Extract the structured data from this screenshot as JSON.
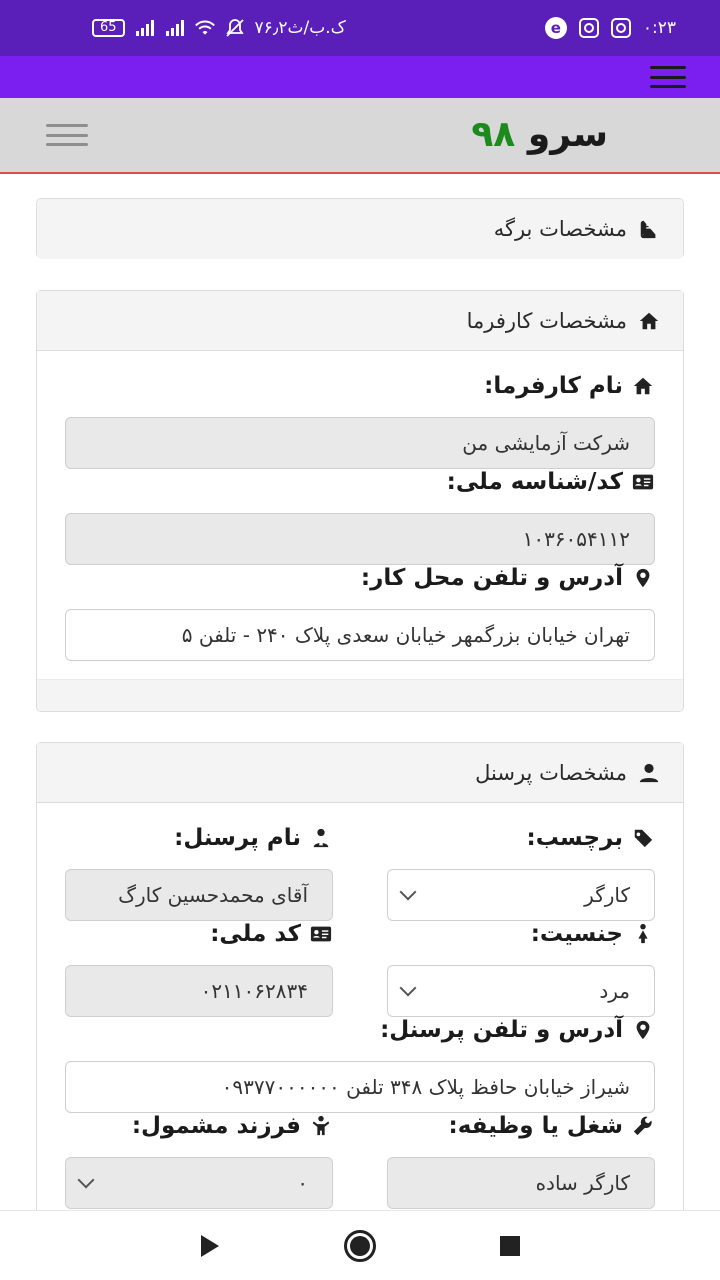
{
  "status_bar": {
    "time": "۰:۲۳",
    "network_speed": "۷۶٫۲ک.ب/ث",
    "battery": "65"
  },
  "header": {
    "brand_text": "سرو",
    "brand_number": "۹۸"
  },
  "sections": {
    "sheet": {
      "title": "مشخصات برگه"
    },
    "employer": {
      "title": "مشخصات کارفرما",
      "name_label": "نام کارفرما:",
      "name_value": "شرکت آزمایشی من",
      "national_id_label": "کد/شناسه ملی:",
      "national_id_value": "۱۰۳۶۰۵۴۱۱۲",
      "address_label": "آدرس و تلفن محل کار:",
      "address_value": "تهران خیابان بزرگمهر خیابان سعدی پلاک ۲۴۰ - تلفن ۵"
    },
    "personnel": {
      "title": "مشخصات پرسنل",
      "tag_label": "برچسب:",
      "tag_value": "کارگر",
      "name_label": "نام پرسنل:",
      "name_value": "آقای محمدحسین کارگ",
      "gender_label": "جنسیت:",
      "gender_value": "مرد",
      "national_code_label": "کد ملی:",
      "national_code_value": "۰۲۱۱۰۶۲۸۳۴",
      "address_label": "آدرس و تلفن پرسنل:",
      "address_value": "شیراز خیابان حافظ پلاک ۳۴۸ تلفن ۰۹۳۷۷۰۰۰۰۰۰",
      "job_label": "شغل یا وظیفه:",
      "job_value": "کارگر ساده",
      "children_label": "فرزند مشمول:",
      "children_value": "۰"
    }
  }
}
